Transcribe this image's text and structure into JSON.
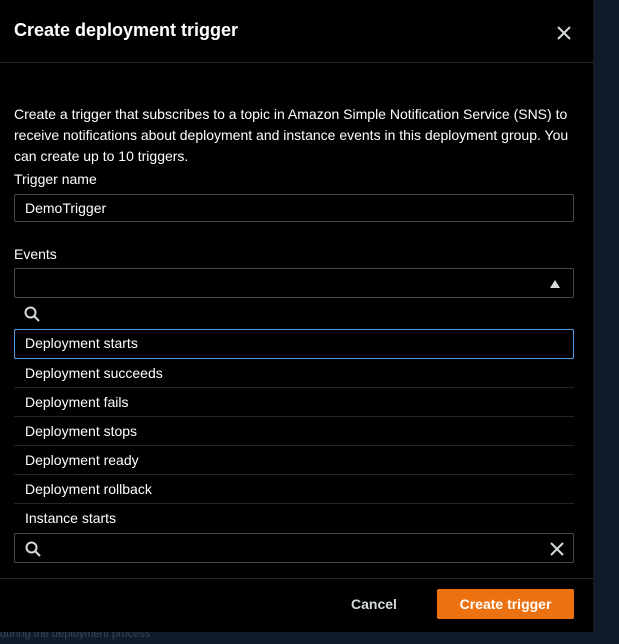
{
  "modal": {
    "title": "Create deployment trigger",
    "description": "Create a trigger that subscribes to a topic in Amazon Simple Notification Service (SNS) to receive notifications about deployment and instance events in this deployment group. You can create up to 10 triggers."
  },
  "form": {
    "trigger_name_label": "Trigger name",
    "trigger_name_value": "DemoTrigger",
    "events_label": "Events",
    "events_options": [
      "Deployment starts",
      "Deployment succeeds",
      "Deployment fails",
      "Deployment stops",
      "Deployment ready",
      "Deployment rollback",
      "Instance starts"
    ]
  },
  "footer": {
    "cancel_label": "Cancel",
    "create_label": "Create trigger"
  },
  "background": {
    "partial_text": "during the deployment process"
  },
  "colors": {
    "primary_button": "#ec7211",
    "focus_border": "#539fe5"
  },
  "icons": {
    "close": "close-icon",
    "caret": "caret-up-icon",
    "search": "search-icon",
    "clear": "clear-icon"
  }
}
